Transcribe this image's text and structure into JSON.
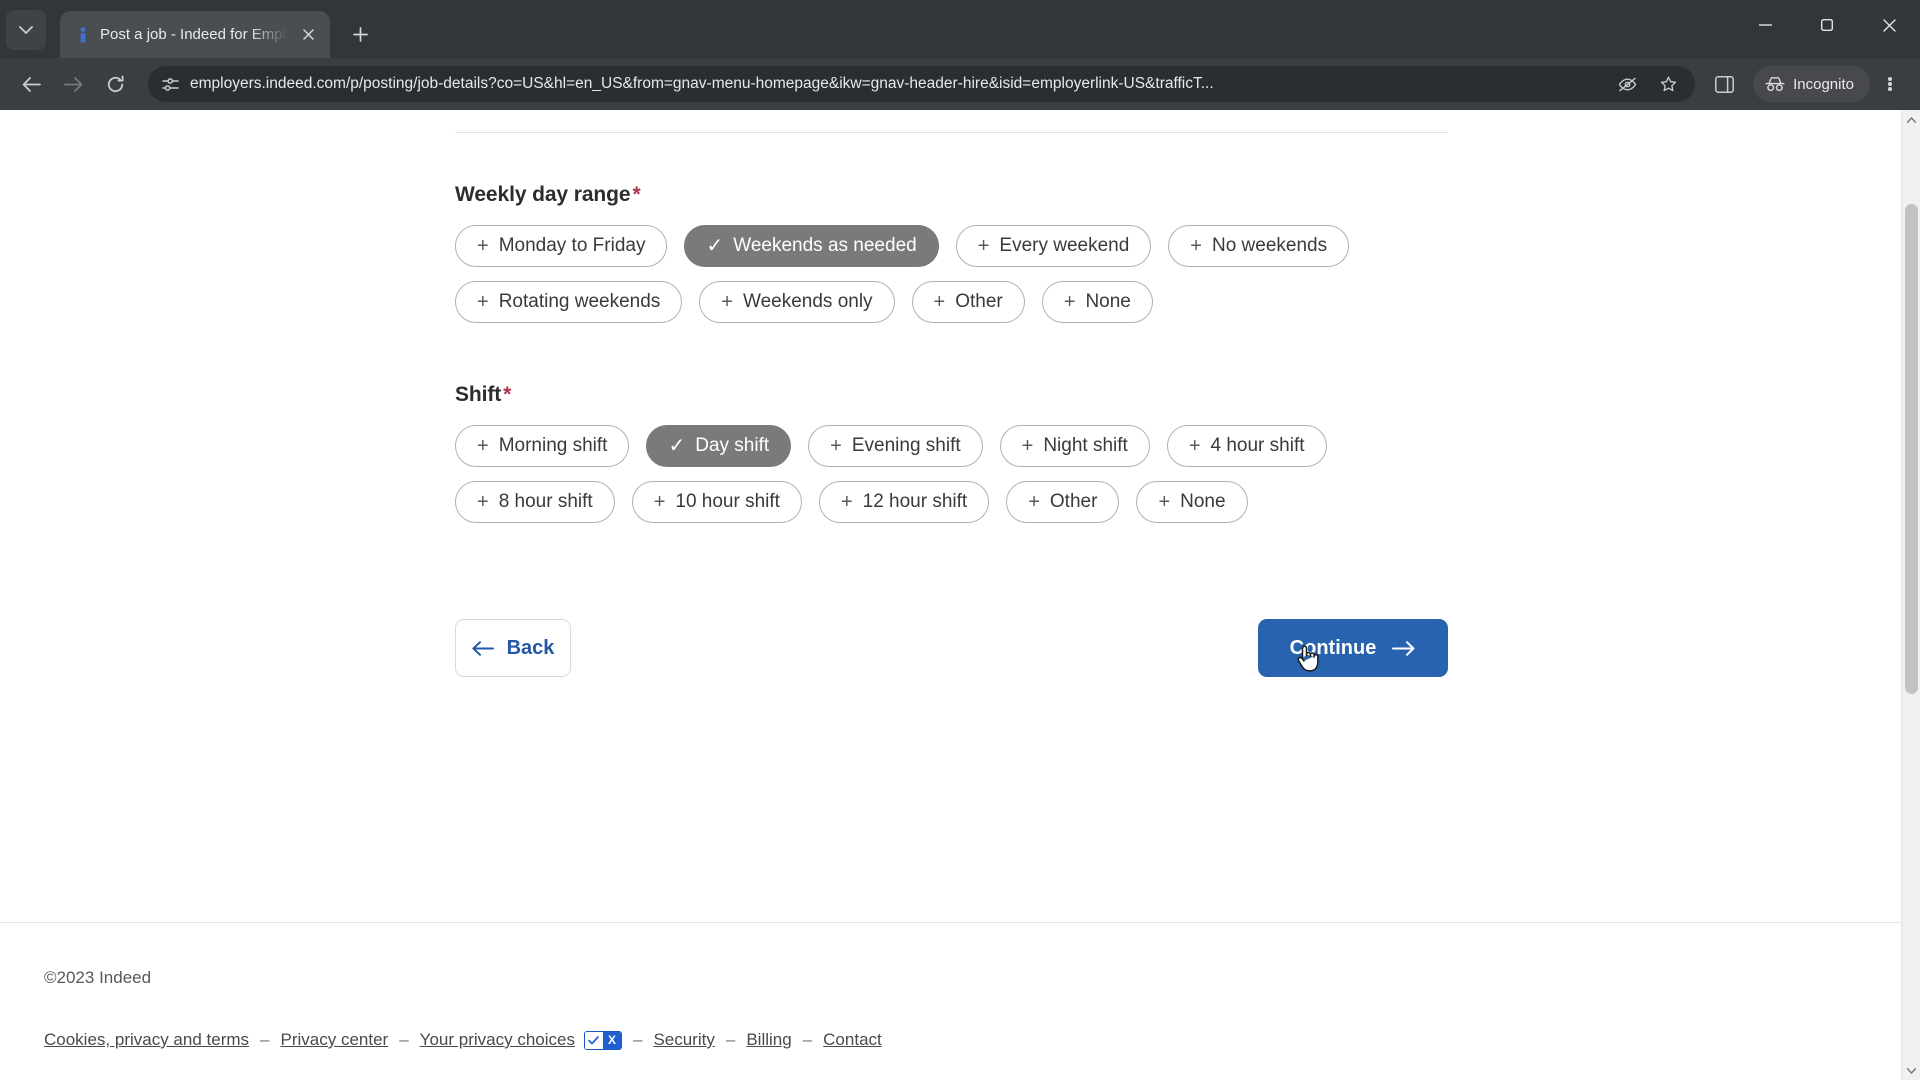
{
  "browser": {
    "tab": {
      "title": "Post a job - Indeed for Employers",
      "favicon_name": "indeed-favicon"
    },
    "new_tab_label": "+",
    "url": "employers.indeed.com/p/posting/job-details?co=US&hl=en_US&from=gnav-menu-homepage&ikw=gnav-header-hire&isid=employerlink-US&trafficT...",
    "incognito_label": "Incognito",
    "accent_blue": "#2863b0"
  },
  "form": {
    "weekly_day_range": {
      "label": "Weekly day range",
      "required_marker": "*",
      "options": [
        {
          "label": "Monday to Friday",
          "selected": false
        },
        {
          "label": "Weekends as needed",
          "selected": true
        },
        {
          "label": "Every weekend",
          "selected": false
        },
        {
          "label": "No weekends",
          "selected": false
        },
        {
          "label": "Rotating weekends",
          "selected": false
        },
        {
          "label": "Weekends only",
          "selected": false
        },
        {
          "label": "Other",
          "selected": false
        },
        {
          "label": "None",
          "selected": false
        }
      ]
    },
    "shift": {
      "label": "Shift",
      "required_marker": "*",
      "options": [
        {
          "label": "Morning shift",
          "selected": false
        },
        {
          "label": "Day shift",
          "selected": true
        },
        {
          "label": "Evening shift",
          "selected": false
        },
        {
          "label": "Night shift",
          "selected": false
        },
        {
          "label": "4 hour shift",
          "selected": false
        },
        {
          "label": "8 hour shift",
          "selected": false
        },
        {
          "label": "10 hour shift",
          "selected": false
        },
        {
          "label": "12 hour shift",
          "selected": false
        },
        {
          "label": "Other",
          "selected": false
        },
        {
          "label": "None",
          "selected": false
        }
      ]
    },
    "actions": {
      "back_label": "Back",
      "continue_label": "Continue"
    },
    "chip_add_glyph": "+",
    "chip_selected_glyph": "✓",
    "selected_chip_color": "#7c7a78"
  },
  "footer": {
    "copyright": "©2023 Indeed",
    "links": [
      "Cookies, privacy and terms",
      "Privacy center",
      "Your privacy choices",
      "Security",
      "Billing",
      "Contact"
    ],
    "separator": "–",
    "privacy_badge": {
      "check": "✓",
      "cross": "X"
    }
  }
}
